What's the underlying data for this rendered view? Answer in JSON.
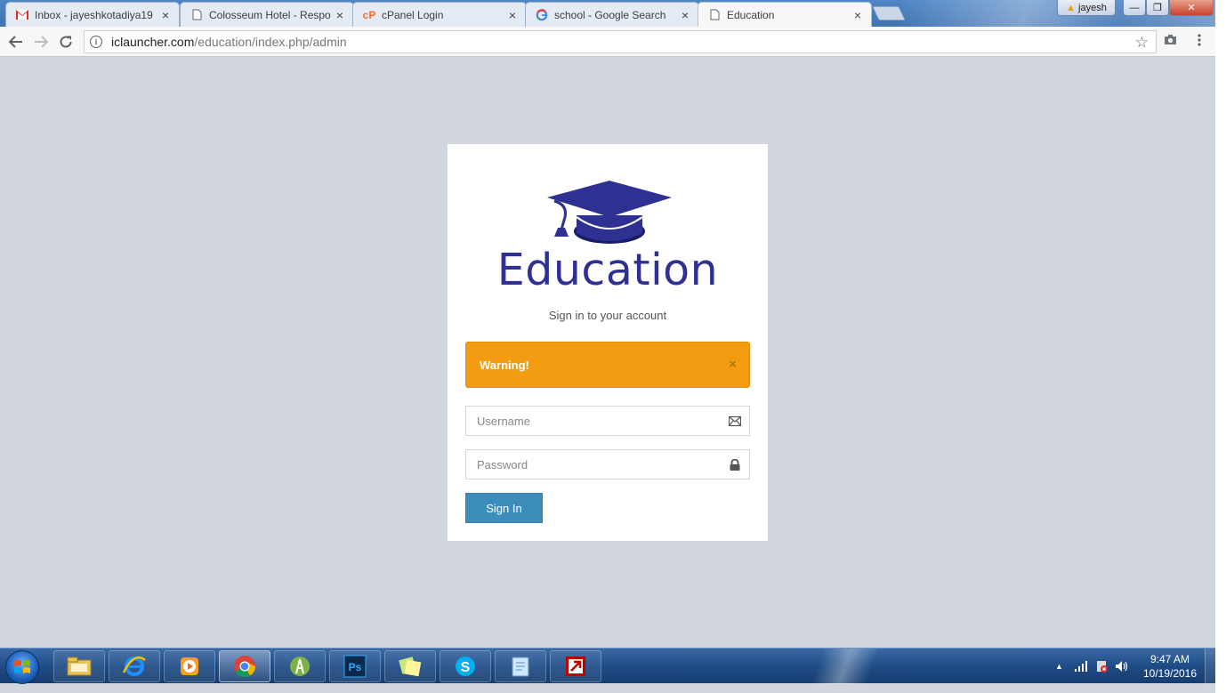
{
  "browser": {
    "tabs": [
      {
        "title": "Inbox - jayeshkotadiya19",
        "favicon": "gmail-icon"
      },
      {
        "title": "Colosseum Hotel - Respo",
        "favicon": "page-icon"
      },
      {
        "title": "cPanel Login",
        "favicon": "cpanel-icon"
      },
      {
        "title": "school - Google Search",
        "favicon": "google-icon"
      },
      {
        "title": "Education",
        "favicon": "page-icon",
        "active": true
      }
    ],
    "profile_name": "jayesh",
    "url_host": "iclauncher.com",
    "url_path": "/education/index.php/admin"
  },
  "login": {
    "logo_text": "Education",
    "subtitle": "Sign in to your account",
    "warning_text": "Warning!",
    "alert_close": "×",
    "username_placeholder": "Username",
    "password_placeholder": "Password",
    "signin_label": "Sign In",
    "colors": {
      "primary": "#3c8dbc",
      "warning": "#f39c12",
      "logo": "#2e3192",
      "background": "#d2d6de"
    }
  },
  "taskbar": {
    "apps": [
      "file-explorer",
      "internet-explorer",
      "media-player",
      "chrome",
      "android-studio",
      "photoshop",
      "sticky-notes",
      "skype",
      "notepad",
      "filezilla"
    ],
    "time": "9:47 AM",
    "date": "10/19/2016"
  }
}
